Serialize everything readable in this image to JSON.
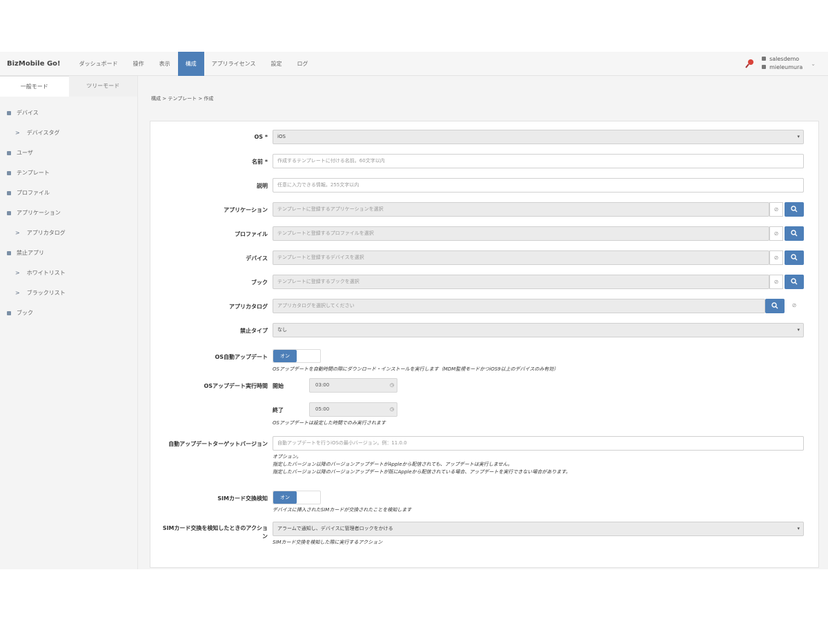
{
  "app": {
    "brand": "BizMobile Go!"
  },
  "nav": {
    "items": [
      "ダッシュボード",
      "操作",
      "表示",
      "構成",
      "アプリライセンス",
      "設定",
      "ログ"
    ],
    "active_index": 3
  },
  "user": {
    "line1": "salesdemo",
    "line2": "mieleumura"
  },
  "sidebar": {
    "mode_tabs": [
      "一般モード",
      "ツリーモード"
    ],
    "items": [
      {
        "label": "デバイス",
        "level": 0
      },
      {
        "label": "デバイスタグ",
        "level": 1
      },
      {
        "label": "ユーザ",
        "level": 0
      },
      {
        "label": "テンプレート",
        "level": 0
      },
      {
        "label": "プロファイル",
        "level": 0
      },
      {
        "label": "アプリケーション",
        "level": 0
      },
      {
        "label": "アプリカタログ",
        "level": 1
      },
      {
        "label": "禁止アプリ",
        "level": 0
      },
      {
        "label": "ホワイトリスト",
        "level": 1
      },
      {
        "label": "ブラックリスト",
        "level": 1
      },
      {
        "label": "ブック",
        "level": 0
      }
    ]
  },
  "breadcrumb": "構成 > テンプレート > 作成",
  "form": {
    "os": {
      "label": "OS *",
      "value": "iOS"
    },
    "name": {
      "label": "名前 *",
      "placeholder": "作成するテンプレートに付ける名前。60文字以内"
    },
    "desc": {
      "label": "説明",
      "placeholder": "任意に入力できる情報。255文字以内"
    },
    "apps": {
      "label": "アプリケーション",
      "placeholder": "テンプレートに登録するアプリケーションを選択"
    },
    "profiles": {
      "label": "プロファイル",
      "placeholder": "テンプレートと登録するプロファイルを選択"
    },
    "devices": {
      "label": "デバイス",
      "placeholder": "テンプレートと登録するデバイスを選択"
    },
    "books": {
      "label": "ブック",
      "placeholder": "テンプレートに登録するブックを選択"
    },
    "catalog": {
      "label": "アプリカタログ",
      "placeholder": "アプリカタログを選択してください"
    },
    "forbid_type": {
      "label": "禁止タイプ",
      "value": "なし"
    },
    "os_auto_update": {
      "label": "OS自動アップデート",
      "toggle": "オン",
      "help": "OSアップデートを自動時間の際にダウンロード・インストールを実行します（MDM監視モードかつiOS9以上のデバイスのみ有効）"
    },
    "os_update_time": {
      "label": "OSアップデート実行時間",
      "start_label": "開始",
      "start_value": "03:00",
      "end_label": "終了",
      "end_value": "05:00",
      "help": "OSアップデートは設定した時間でのみ実行されます"
    },
    "target_version": {
      "label": "自動アップデートターゲットバージョン",
      "placeholder": "自動アップデートを行うiOSの最小バージョン。例：11.0.0",
      "help1": "オプション。",
      "help2": "指定したバージョン以降のバージョンアップデートがAppleから配信されても、アップデートは実行しません。",
      "help3": "指定したバージョン以降のバージョンアップデートが既にAppleから配信されている場合、アップデートを実行できない場合があります。"
    },
    "sim_detect": {
      "label": "SIMカード交換検知",
      "toggle": "オン",
      "help": "デバイスに挿入されたSIMカードが交換されたことを検知します"
    },
    "sim_action": {
      "label": "SIMカード交換を検知したときのアクション",
      "value": "アラームで通知し、デバイスに管理者ロックをかける",
      "help": "SIMカード交換を検知した際に実行するアクション"
    }
  },
  "colors": {
    "accent": "#4d7fb8",
    "background": "#f4f4f4"
  }
}
